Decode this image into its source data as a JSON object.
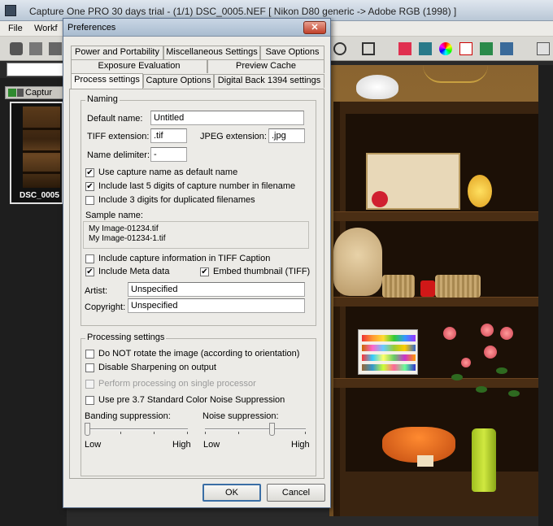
{
  "window": {
    "title": "Capture One PRO 30 days trial  -  (1/1) DSC_0005.NEF  [ Nikon D80 generic -> Adobe RGB (1998) ]"
  },
  "menubar": {
    "items": [
      "File",
      "Workf"
    ]
  },
  "left_panel": {
    "tab_label": "Captur",
    "thumbnail_caption": "DSC_0005"
  },
  "dialog": {
    "title": "Preferences",
    "close_symbol": "✕",
    "tabs_row1": [
      "Power and Portability",
      "Miscellaneous Settings",
      "Save Options"
    ],
    "tabs_row2": [
      "Exposure Evaluation",
      "Preview Cache"
    ],
    "tabs_row3": [
      "Process settings",
      "Capture Options",
      "Digital Back 1394 settings"
    ],
    "active_tab": "Process settings",
    "naming": {
      "group_label": "Naming",
      "default_name_label": "Default name:",
      "default_name_value": "Untitled",
      "tiff_ext_label": "TIFF extension:",
      "tiff_ext_value": ".tif",
      "jpeg_ext_label": "JPEG extension:",
      "jpeg_ext_value": ".jpg",
      "delimiter_label": "Name delimiter:",
      "delimiter_value": "-",
      "cb_use_capture_name": "Use capture name as default name",
      "cb_include_last5": "Include last 5 digits of capture number in filename",
      "cb_include_3digits": "Include 3 digits for duplicated filenames",
      "sample_name_label": "Sample name:",
      "sample_lines": [
        "My Image-01234.tif",
        "My Image-01234-1.tif"
      ],
      "cb_capture_info_caption": "Include capture information in TIFF Caption",
      "cb_include_meta": "Include Meta data",
      "cb_embed_thumb": "Embed thumbnail (TIFF)",
      "artist_label": "Artist:",
      "artist_value": "Unspecified",
      "copyright_label": "Copyright:",
      "copyright_value": "Unspecified"
    },
    "checks": {
      "use_capture_name": true,
      "include_last5": true,
      "include_3digits": false,
      "capture_info_caption": false,
      "include_meta": true,
      "embed_thumb": true,
      "not_rotate": false,
      "disable_sharpening": false,
      "single_processor": false,
      "pre37_noise": false
    },
    "processing": {
      "group_label": "Processing settings",
      "cb_not_rotate": "Do NOT rotate the image (according to orientation)",
      "cb_disable_sharpening": "Disable Sharpening on output",
      "cb_single_processor": "Perform processing on single processor",
      "cb_pre37_noise": "Use pre 3.7 Standard Color Noise Suppression",
      "banding_label": "Banding suppression:",
      "noise_label": "Noise suppression:",
      "low_label": "Low",
      "high_label": "High",
      "banding_level": 0.0,
      "noise_level": 0.67
    },
    "buttons": {
      "ok": "OK",
      "cancel": "Cancel"
    }
  },
  "colors": {
    "dialog_bg": "#ecebe7",
    "title_gradient": "#a9bccf",
    "close_red": "#c0402a",
    "default_button_border": "#3a6ea5"
  }
}
